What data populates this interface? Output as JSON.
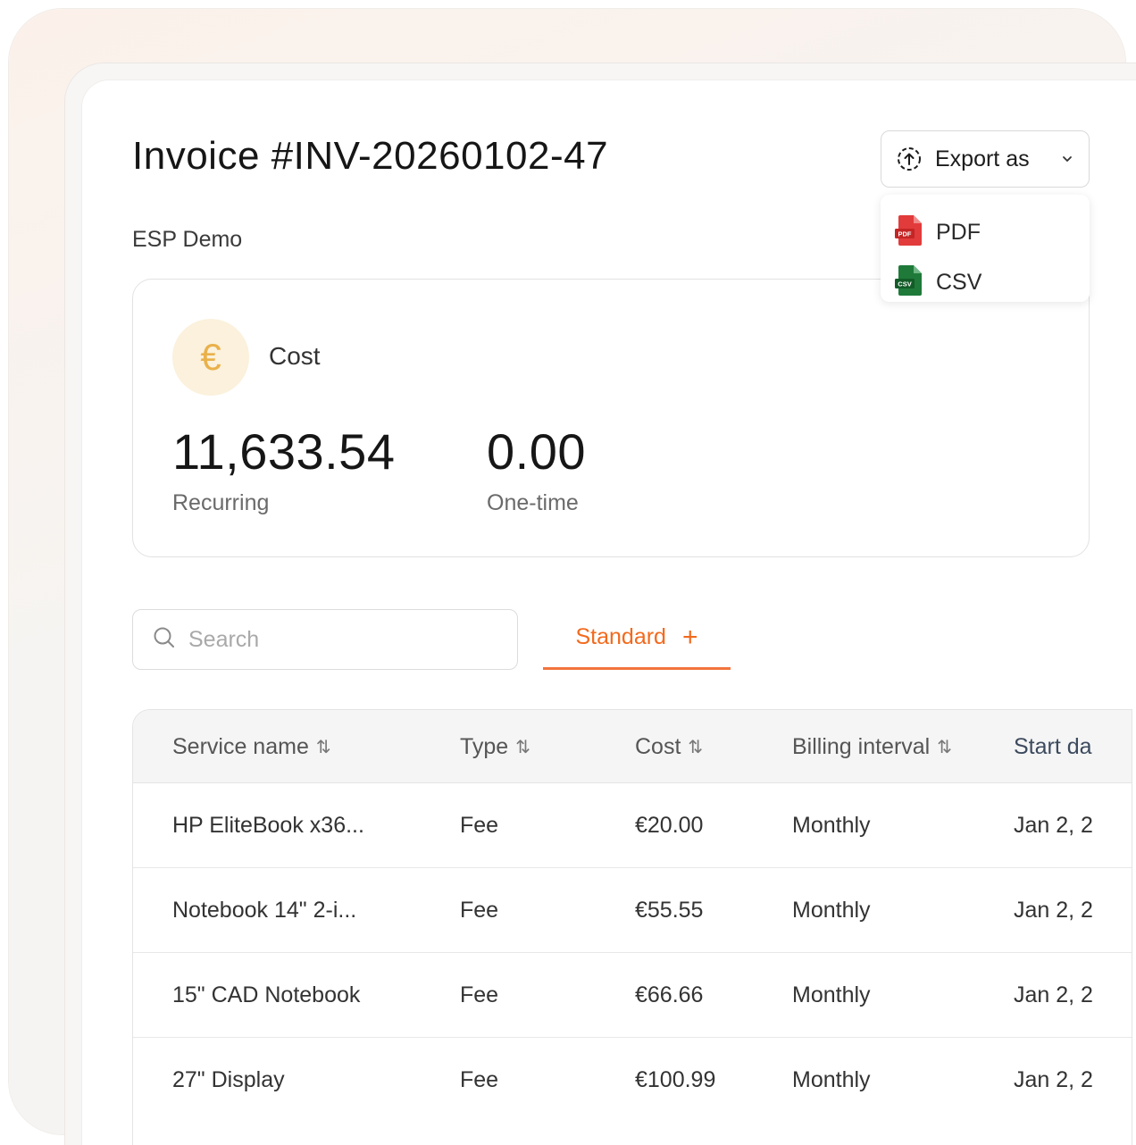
{
  "invoice": {
    "title": "Invoice #INV-20260102-47",
    "customer": "ESP Demo"
  },
  "export": {
    "button_label": "Export as",
    "menu": [
      {
        "label": "PDF",
        "badge": "PDF",
        "color": "#e23b3b"
      },
      {
        "label": "CSV",
        "badge": "CSV",
        "color": "#1f7a3a"
      }
    ]
  },
  "cost_card": {
    "label": "Cost",
    "icon": "€",
    "recurring_value": "11,633.54",
    "recurring_label": "Recurring",
    "onetime_value": "0.00",
    "onetime_label": "One-time"
  },
  "search": {
    "placeholder": "Search"
  },
  "tabs": [
    {
      "label": "Standard",
      "active": true,
      "add_icon": "+"
    }
  ],
  "colors": {
    "accent": "#f26a1d",
    "euro_bg": "#fbf1dc",
    "euro_fg": "#eab14a"
  },
  "table": {
    "columns": [
      "Service name",
      "Type",
      "Cost",
      "Billing interval",
      "Start da"
    ],
    "sort_icon": "⇅",
    "rows": [
      {
        "name": "HP EliteBook x36...",
        "type": "Fee",
        "cost": "€20.00",
        "interval": "Monthly",
        "start": "Jan 2, 2"
      },
      {
        "name": "Notebook 14\" 2-i...",
        "type": "Fee",
        "cost": "€55.55",
        "interval": "Monthly",
        "start": "Jan 2, 2"
      },
      {
        "name": "15\" CAD Notebook",
        "type": "Fee",
        "cost": "€66.66",
        "interval": "Monthly",
        "start": "Jan 2, 2"
      },
      {
        "name": "27\" Display",
        "type": "Fee",
        "cost": "€100.99",
        "interval": "Monthly",
        "start": "Jan 2, 2"
      }
    ]
  }
}
